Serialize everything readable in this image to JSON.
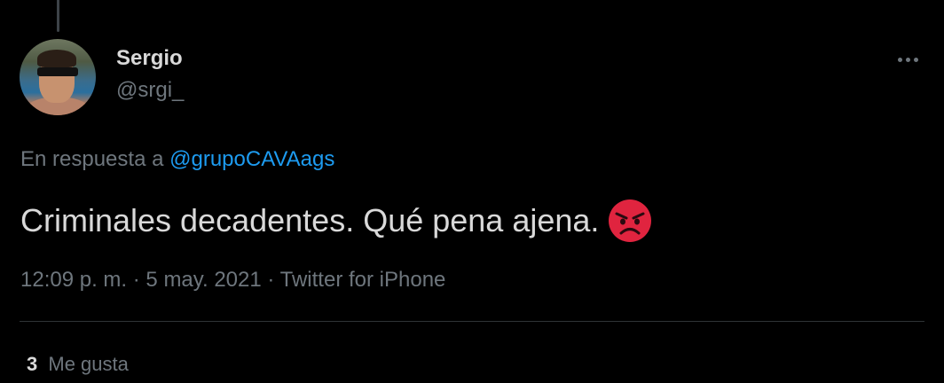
{
  "tweet": {
    "author_name": "Sergio",
    "author_handle": "@srgi_",
    "reply_prefix": "En respuesta a",
    "reply_to": "@grupoCAVAags",
    "text": "Criminales decadentes. Qué pena ajena.",
    "emoji": "angry-face",
    "timestamp": "12:09 p. m.",
    "date": "5 may. 2021",
    "source": "Twitter for iPhone",
    "separator": "·"
  },
  "stats": {
    "likes_count": "3",
    "likes_label": "Me gusta"
  },
  "colors": {
    "background": "#000000",
    "text": "#d9d9d9",
    "secondary": "#6e767d",
    "link": "#1d9bf0",
    "divider": "#2f3336"
  }
}
